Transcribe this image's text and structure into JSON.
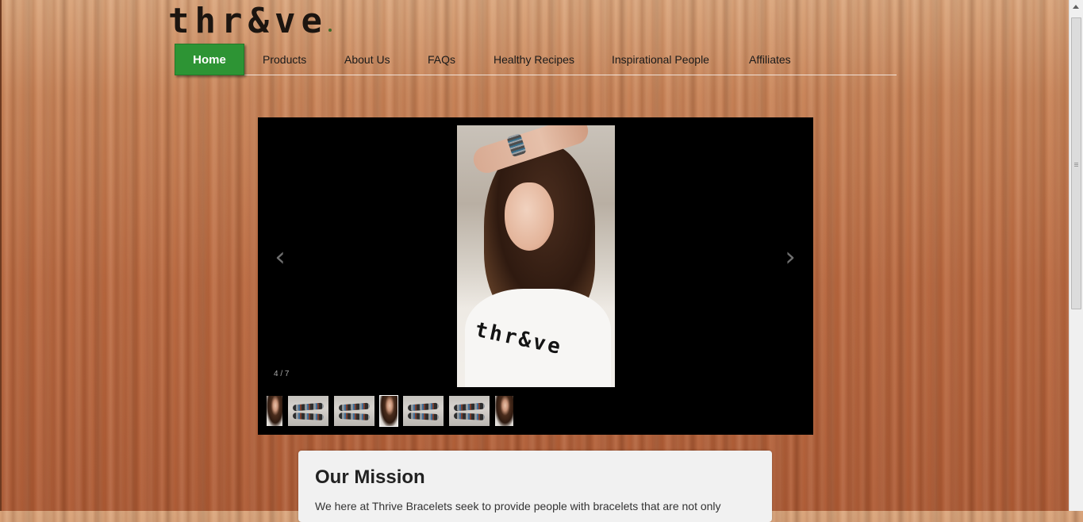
{
  "logo": {
    "text": "thr&ve"
  },
  "nav": {
    "items": [
      {
        "label": "Home",
        "active": true
      },
      {
        "label": "Products"
      },
      {
        "label": "About Us"
      },
      {
        "label": "FAQs"
      },
      {
        "label": "Healthy Recipes"
      },
      {
        "label": "Inspirational People"
      },
      {
        "label": "Affiliates"
      }
    ],
    "active_color": "#2d9434"
  },
  "slider": {
    "counter": "4 / 7",
    "current_slide": 4,
    "total_slides": 7,
    "prev_icon": "chevron-left-icon",
    "next_icon": "chevron-right-icon",
    "prev_glyph": "‹",
    "next_glyph": "›",
    "shirt_text": "thr&ve",
    "thumbnails": [
      {
        "type": "portrait"
      },
      {
        "type": "bracelet"
      },
      {
        "type": "bracelet"
      },
      {
        "type": "portrait"
      },
      {
        "type": "bracelet"
      },
      {
        "type": "bracelet"
      },
      {
        "type": "portrait"
      }
    ]
  },
  "mission": {
    "title": "Our Mission",
    "text": "We here at Thrive Bracelets seek to provide people with bracelets that are not only"
  }
}
